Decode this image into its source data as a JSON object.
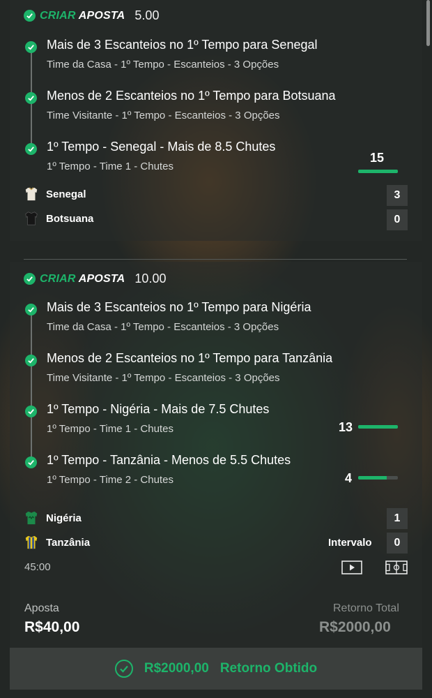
{
  "bet1": {
    "brand_a": "CRIAR",
    "brand_b": "APOSTA",
    "odds": "5.00",
    "selections": [
      {
        "title": "Mais de 3 Escanteios no 1º Tempo para Senegal",
        "sub": "Time da Casa - 1º Tempo - Escanteios - 3 Opções"
      },
      {
        "title": "Menos de 2 Escanteios no 1º Tempo para Botsuana",
        "sub": "Time Visitante - 1º Tempo - Escanteios - 3 Opções"
      },
      {
        "title": "1º Tempo - Senegal - Mais de 8.5 Chutes",
        "sub": "1º Tempo - Time 1 - Chutes",
        "stat": "15",
        "progress": 1.0
      }
    ],
    "teams": [
      {
        "name": "Senegal",
        "score": "3",
        "shirt": "white"
      },
      {
        "name": "Botsuana",
        "score": "0",
        "shirt": "black"
      }
    ]
  },
  "bet2": {
    "brand_a": "CRIAR",
    "brand_b": "APOSTA",
    "odds": "10.00",
    "selections": [
      {
        "title": "Mais de 3 Escanteios no 1º Tempo para Nigéria",
        "sub": "Time da Casa - 1º Tempo - Escanteios - 3 Opções"
      },
      {
        "title": "Menos de 2 Escanteios no 1º Tempo para Tanzânia",
        "sub": "Time Visitante - 1º Tempo - Escanteios - 3 Opções"
      },
      {
        "title": "1º Tempo - Nigéria - Mais de 7.5 Chutes",
        "sub": "1º Tempo - Time 1 - Chutes",
        "stat": "13",
        "progress": 1.0
      },
      {
        "title": "1º Tempo - Tanzânia - Menos de 5.5 Chutes",
        "sub": "1º Tempo - Time 2 - Chutes",
        "stat": "4",
        "progress": 0.72
      }
    ],
    "teams": [
      {
        "name": "Nigéria",
        "score": "1",
        "shirt": "green"
      },
      {
        "name": "Tanzânia",
        "score": "0",
        "shirt": "striped",
        "status": "Intervalo"
      }
    ],
    "clock": "45:00"
  },
  "footer": {
    "stake_label": "Aposta",
    "stake_value": "R$40,00",
    "return_label": "Retorno Total",
    "return_value": "R$2000,00"
  },
  "result": {
    "amount": "R$2000,00",
    "label": "Retorno Obtido"
  },
  "colors": {
    "accent": "#1db46a",
    "background": "#232725"
  },
  "icons": [
    "check-circle-icon",
    "play-icon",
    "pitch-icon",
    "jersey-icon"
  ]
}
